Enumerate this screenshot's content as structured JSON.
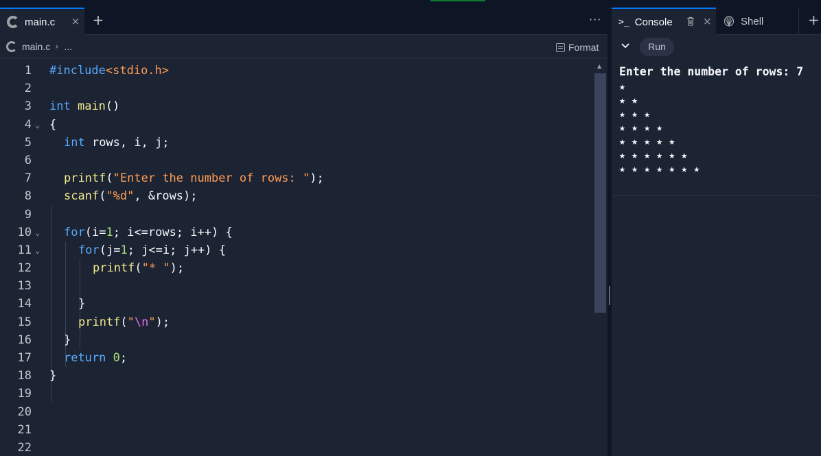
{
  "editor": {
    "tab": {
      "label": "main.c",
      "close": "×"
    },
    "add_tab": "+",
    "more": "···",
    "breadcrumb": {
      "file": "main.c",
      "sep": "›",
      "more": "..."
    },
    "format_label": "Format",
    "lines": [
      {
        "n": "1",
        "fold": ""
      },
      {
        "n": "2",
        "fold": ""
      },
      {
        "n": "3",
        "fold": ""
      },
      {
        "n": "4",
        "fold": "⌄"
      },
      {
        "n": "5",
        "fold": ""
      },
      {
        "n": "6",
        "fold": ""
      },
      {
        "n": "7",
        "fold": ""
      },
      {
        "n": "8",
        "fold": ""
      },
      {
        "n": "9",
        "fold": ""
      },
      {
        "n": "10",
        "fold": "⌄"
      },
      {
        "n": "11",
        "fold": "⌄"
      },
      {
        "n": "12",
        "fold": ""
      },
      {
        "n": "13",
        "fold": ""
      },
      {
        "n": "14",
        "fold": ""
      },
      {
        "n": "15",
        "fold": ""
      },
      {
        "n": "16",
        "fold": ""
      },
      {
        "n": "17",
        "fold": ""
      },
      {
        "n": "18",
        "fold": ""
      },
      {
        "n": "19",
        "fold": ""
      },
      {
        "n": "20",
        "fold": ""
      },
      {
        "n": "21",
        "fold": ""
      },
      {
        "n": "22",
        "fold": ""
      }
    ],
    "code": {
      "l1": [
        "#include",
        "<stdio.h>"
      ],
      "l3": [
        "int",
        " ",
        "main",
        "()"
      ],
      "l4": [
        "{"
      ],
      "l5": [
        "int",
        " rows, i, j;"
      ],
      "l7": [
        "printf",
        "(",
        "\"Enter the number of rows: \"",
        ");"
      ],
      "l8": [
        "scanf",
        "(",
        "\"%d\"",
        ", &rows);"
      ],
      "l10": [
        "for",
        "(i=",
        "1",
        "; i<=rows; i++) {"
      ],
      "l11": [
        "for",
        "(j=",
        "1",
        "; j<=i; j++) {"
      ],
      "l12": [
        "printf",
        "(",
        "\"* \"",
        ");"
      ],
      "l14": [
        "}"
      ],
      "l15": [
        "printf",
        "(",
        "\"",
        "\\n",
        "\"",
        ");"
      ],
      "l16": [
        "}"
      ],
      "l17": [
        "return",
        " ",
        "0",
        ";"
      ],
      "l18": [
        "}"
      ]
    }
  },
  "console": {
    "tab_console": {
      "icon": ">_",
      "label": "Console",
      "close": "×"
    },
    "tab_shell": {
      "label": "Shell"
    },
    "add_tab": "+",
    "run_label": "Run",
    "output": [
      "Enter the number of rows: 7",
      "★",
      "★ ★",
      "★ ★ ★",
      "★ ★ ★ ★",
      "★ ★ ★ ★ ★",
      "★ ★ ★ ★ ★ ★",
      "★ ★ ★ ★ ★ ★ ★"
    ]
  },
  "colors": {
    "keyword": "#57abff",
    "function": "#f2e98c",
    "string": "#ff9e54",
    "number": "#a5e075",
    "escape": "#e56ff2",
    "accent": "#0079f2"
  }
}
